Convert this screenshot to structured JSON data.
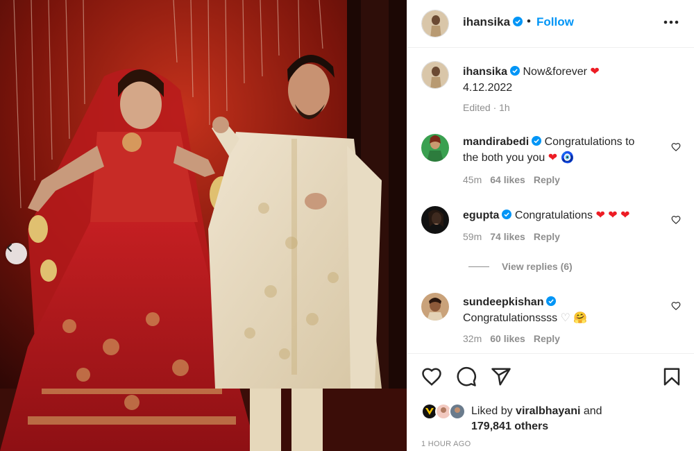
{
  "photo": {
    "alt_subject": "",
    "prev_icon": "chevron-left-icon"
  },
  "header": {
    "username": "ihansika",
    "separator": "•",
    "follow_label": "Follow",
    "more_icon": "more-horizontal-icon"
  },
  "caption": {
    "username": "ihansika",
    "text": "Now&forever",
    "emoji": "❤",
    "date": "4.12.2022",
    "meta": "Edited · 1h"
  },
  "comments": [
    {
      "username": "mandirabedi",
      "text": "Congratulations to",
      "text2": "the both you you",
      "emoji": "❤",
      "emoji2": "🧿",
      "time": "45m",
      "likes": "64 likes",
      "reply": "Reply"
    },
    {
      "username": "egupta",
      "text": "Congratulations",
      "emoji": "❤ ❤ ❤",
      "time": "59m",
      "likes": "74 likes",
      "reply": "Reply"
    },
    {
      "username": "sundeepkishan",
      "text": "Congratulationssss",
      "emoji": "♡",
      "emoji2": "🤗",
      "time": "32m",
      "likes": "60 likes",
      "reply": "Reply"
    }
  ],
  "view_replies": "View replies (6)",
  "actions": {
    "like_icon": "heart-icon",
    "comment_icon": "comment-icon",
    "share_icon": "share-icon",
    "save_icon": "bookmark-icon"
  },
  "likes": {
    "prefix": "Liked by ",
    "user": "viralbhayani",
    "middle": " and",
    "count": "179,841 others"
  },
  "timestamp": "1 HOUR AGO",
  "colors": {
    "accent": "#0095f6",
    "verified": "#0095f6",
    "heart": "#ed1c24",
    "text": "#262626",
    "muted": "#8e8e8e"
  }
}
